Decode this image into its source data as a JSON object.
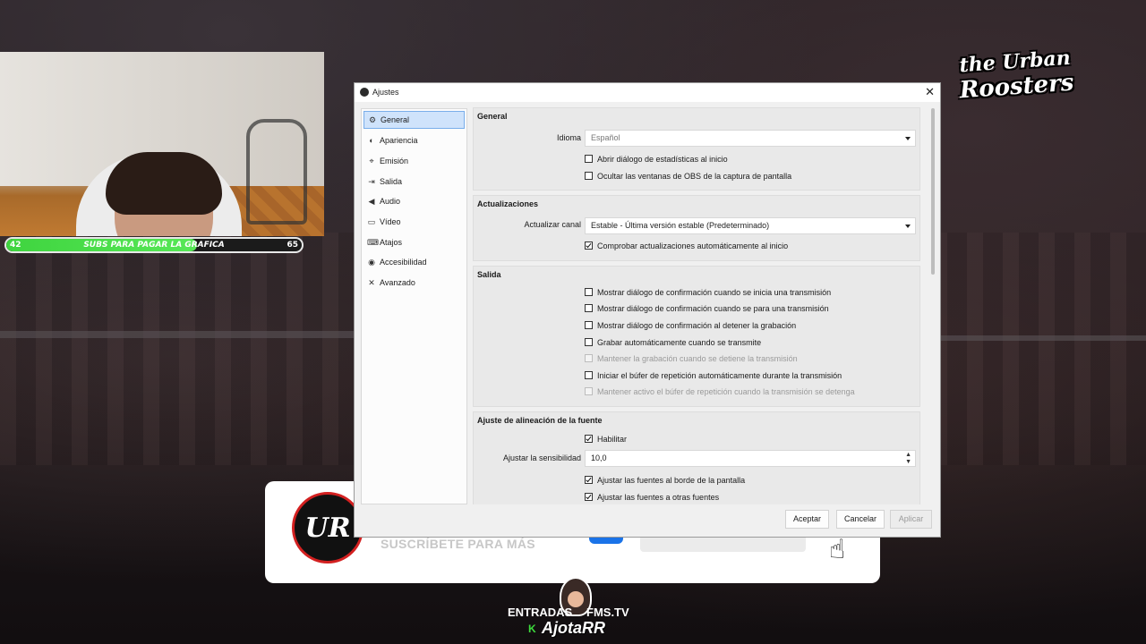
{
  "colors": {
    "accent": "#79aeea",
    "selected": "#cfe3fb",
    "progress": "#3fd43f",
    "brand_red": "#d32020"
  },
  "overlay": {
    "subs_goal": {
      "current": "42",
      "label": "SUBS PARA PAGAR LA GRAFICA",
      "goal": "65",
      "progress_fraction": 0.646
    },
    "brand_logo": "the Urban Roosters",
    "banner": {
      "logo": "UR",
      "text": "SUSCRÍBETE PARA MÁS",
      "icon": "pointer-hand-icon"
    },
    "credits": {
      "entrada": "ENTRADAS",
      "fms": "FMS.TV",
      "k": "K",
      "name": "AjotaRR"
    }
  },
  "dialog": {
    "title": "Ajustes",
    "close": "✕",
    "sidebar": [
      {
        "label": "General",
        "icon": "gear-icon",
        "glyph": "⚙",
        "selected": true
      },
      {
        "label": "Apariencia",
        "icon": "palette-icon",
        "glyph": "◐",
        "selected": false
      },
      {
        "label": "Emisión",
        "icon": "antenna-icon",
        "glyph": "⌖",
        "selected": false
      },
      {
        "label": "Salida",
        "icon": "output-icon",
        "glyph": "⇥",
        "selected": false
      },
      {
        "label": "Audio",
        "icon": "speaker-icon",
        "glyph": "◀",
        "selected": false
      },
      {
        "label": "Vídeo",
        "icon": "monitor-icon",
        "glyph": "▭",
        "selected": false
      },
      {
        "label": "Atajos",
        "icon": "keyboard-icon",
        "glyph": "⌨",
        "selected": false
      },
      {
        "label": "Accesibilidad",
        "icon": "accessibility-icon",
        "glyph": "◉",
        "selected": false
      },
      {
        "label": "Avanzado",
        "icon": "wrench-icon",
        "glyph": "✕",
        "selected": false
      }
    ],
    "general": {
      "header": "General",
      "idioma_label": "Idioma",
      "idioma_value": "Español",
      "checks": [
        {
          "label": "Abrir diálogo de estadísticas al inicio",
          "checked": false
        },
        {
          "label": "Ocultar las ventanas de OBS de la captura de pantalla",
          "checked": false
        }
      ]
    },
    "updates": {
      "header": "Actualizaciones",
      "channel_label": "Actualizar canal",
      "channel_value": "Estable - Última versión estable (Predeterminado)",
      "check": {
        "label": "Comprobar actualizaciones automáticamente al inicio",
        "checked": true
      }
    },
    "output": {
      "header": "Salida",
      "checks": [
        {
          "label": "Mostrar diálogo de confirmación cuando se inicia una transmisión",
          "checked": false,
          "disabled": false
        },
        {
          "label": "Mostrar diálogo de confirmación cuando se para una transmisión",
          "checked": false,
          "disabled": false
        },
        {
          "label": "Mostrar diálogo de confirmación al detener la grabación",
          "checked": false,
          "disabled": false
        },
        {
          "label": "Grabar automáticamente cuando se transmite",
          "checked": false,
          "disabled": false
        },
        {
          "label": "Mantener la grabación cuando se detiene la transmisión",
          "checked": false,
          "disabled": true
        },
        {
          "label": "Iniciar el búfer de repetición automáticamente durante la transmisión",
          "checked": false,
          "disabled": false
        },
        {
          "label": "Mantener activo el búfer de repetición cuando la transmisión se detenga",
          "checked": false,
          "disabled": true
        }
      ]
    },
    "snap": {
      "header": "Ajuste de alineación de la fuente",
      "enable": {
        "label": "Habilitar",
        "checked": true
      },
      "sensitivity_label": "Ajustar la sensibilidad",
      "sensitivity_value": "10,0",
      "checks": [
        {
          "label": "Ajustar las fuentes al borde de la pantalla",
          "checked": true
        },
        {
          "label": "Ajustar las fuentes a otras fuentes",
          "checked": true
        }
      ]
    },
    "buttons": {
      "ok": "Aceptar",
      "cancel": "Cancelar",
      "apply": "Aplicar"
    }
  }
}
